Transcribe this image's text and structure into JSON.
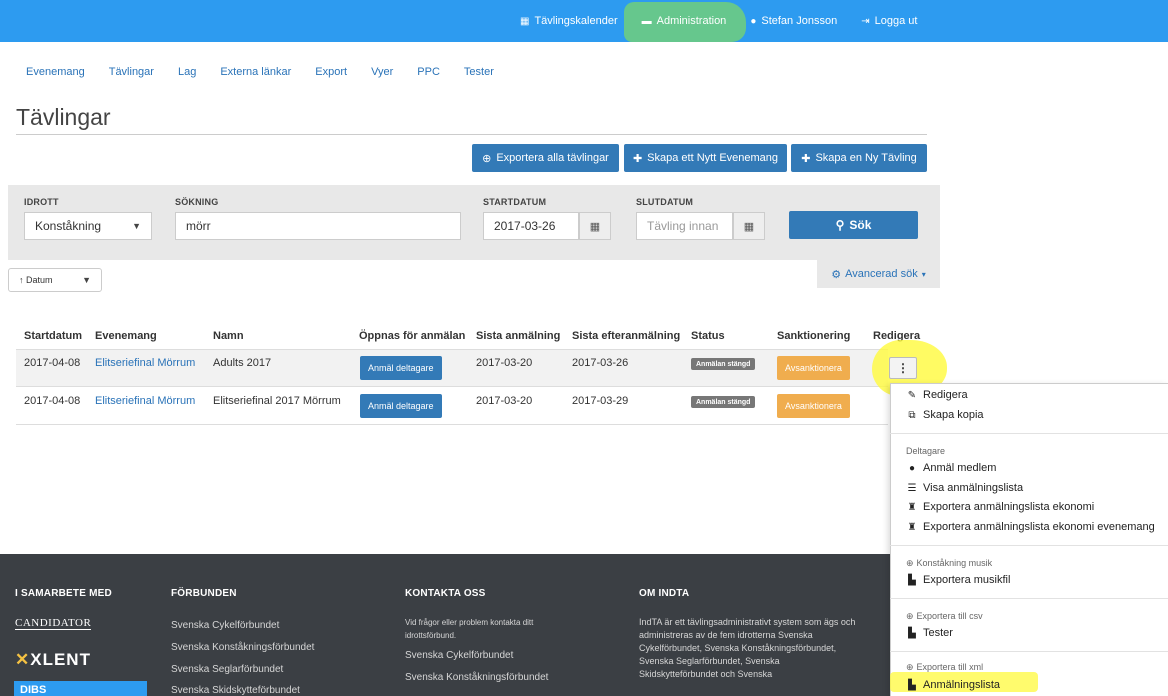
{
  "topnav": {
    "calendar": "Tävlingskalender",
    "admin": "Administration",
    "user": "Stefan Jonsson",
    "logout": "Logga ut"
  },
  "subnav": [
    "Evenemang",
    "Tävlingar",
    "Lag",
    "Externa länkar",
    "Export",
    "Vyer",
    "PPC",
    "Tester"
  ],
  "page_title": "Tävlingar",
  "actions": {
    "export_all": "Exportera alla tävlingar",
    "create_event": "Skapa ett Nytt Evenemang",
    "create_competition": "Skapa en Ny Tävling"
  },
  "filter": {
    "sport_label": "IDROTT",
    "sport_value": "Konståkning",
    "search_label": "SÖKNING",
    "search_value": "mörr",
    "start_label": "STARTDATUM",
    "start_value": "2017-03-26",
    "end_label": "SLUTDATUM",
    "end_placeholder": "Tävling innan",
    "search_button": "Sök",
    "advanced": "Avancerad sök"
  },
  "sort": {
    "value": "↑ Datum"
  },
  "table": {
    "headers": [
      "Startdatum",
      "Evenemang",
      "Namn",
      "Öppnas för anmälan",
      "Sista anmälning",
      "Sista efteranmälning",
      "Status",
      "Sanktionering",
      "Redigera"
    ],
    "rows": [
      {
        "start": "2017-04-08",
        "event": "Elitseriefinal Mörrum",
        "name": "Adults 2017",
        "open_btn": "Anmäl deltagare",
        "last": "2017-03-20",
        "late": "2017-03-26",
        "status": "Anmälan stängd",
        "sanction": "Avsanktionera"
      },
      {
        "start": "2017-04-08",
        "event": "Elitseriefinal Mörrum",
        "name": "Elitseriefinal 2017 Mörrum",
        "open_btn": "Anmäl deltagare",
        "last": "2017-03-20",
        "late": "2017-03-29",
        "status": "Anmälan stängd",
        "sanction": "Avsanktionera"
      }
    ]
  },
  "dropdown": {
    "edit": "Redigera",
    "copy": "Skapa kopia",
    "participants_head": "Deltagare",
    "register_member": "Anmäl medlem",
    "show_list": "Visa anmälningslista",
    "export_economy": "Exportera anmälningslista ekonomi",
    "export_economy_event": "Exportera anmälningslista ekonomi evenemang",
    "music_head": "Konståkning musik",
    "export_music": "Exportera musikfil",
    "csv_head": "Exportera till csv",
    "tester": "Tester",
    "xml_head": "Exportera till xml",
    "registration_list": "Anmälningslista"
  },
  "footer": {
    "partners_head": "I SAMARBETE MED",
    "partner_logos": [
      "CANDIDATOR",
      "XLENT",
      "DIBS"
    ],
    "federations_head": "FÖRBUNDEN",
    "federations": [
      "Svenska Cykelförbundet",
      "Svenska Konståkningsförbundet",
      "Svenska Seglarförbundet",
      "Svenska Skidskytteförbundet"
    ],
    "contact_head": "KONTAKTA OSS",
    "contact_text": "Vid frågor eller problem kontakta ditt idrottsförbund.",
    "contact_links": [
      "Svenska Cykelförbundet",
      "Svenska Konståkningsförbundet"
    ],
    "about_head": "OM INDTA",
    "about_text": "IndTA är ett tävlingsadministrativt system som ägs och administreras av de fem idrotterna Svenska Cykelförbundet, Svenska Konståkningsförbundet, Svenska Seglarförbundet, Svenska Skidskytteförbundet och Svenska"
  }
}
